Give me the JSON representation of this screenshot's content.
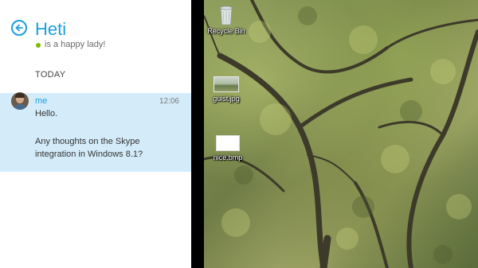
{
  "conversation": {
    "contact_name": "Heti",
    "mood": "is a happy lady!",
    "presence_color": "#7fba00",
    "day_header": "TODAY",
    "message": {
      "sender": "me",
      "time": "12:06",
      "line1": "Hello.",
      "line2": "Any thoughts on the Skype integration in Windows 8.1?"
    },
    "icons": {
      "back": "back-arrow-icon",
      "avatar": "avatar-photo"
    },
    "accent_color": "#1a9fe0",
    "message_bg": "#d4ecfa"
  },
  "desktop": {
    "icons": [
      {
        "label": "Recycle Bin",
        "icon": "recycle-bin-icon"
      },
      {
        "label": "guist.jpg",
        "icon": "jpg-file-icon"
      },
      {
        "label": "nice.bmp",
        "icon": "bmp-file-icon"
      }
    ]
  }
}
